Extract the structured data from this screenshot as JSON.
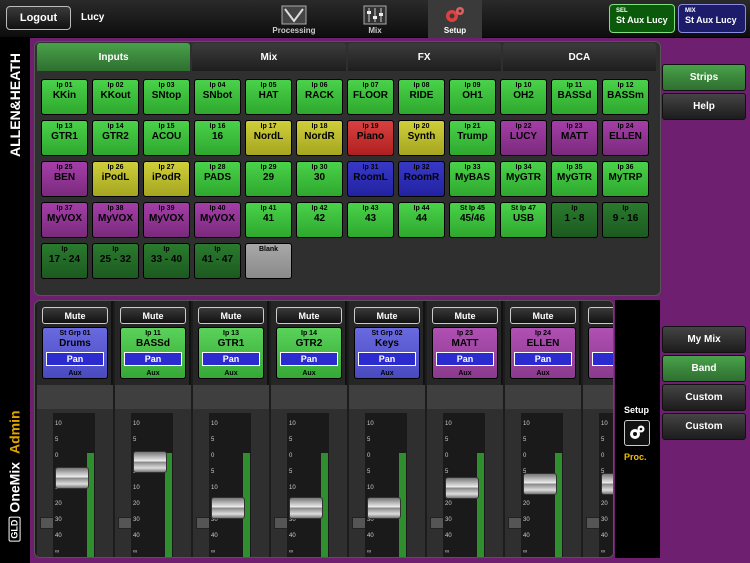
{
  "topbar": {
    "logout_label": "Logout",
    "user": "Lucy",
    "nav": [
      {
        "label": "Processing",
        "icon": "processing-icon"
      },
      {
        "label": "Mix",
        "icon": "mix-icon"
      },
      {
        "label": "Setup",
        "icon": "gear-icon"
      }
    ],
    "sel": {
      "tag": "SEL",
      "value": "St Aux Lucy"
    },
    "mix": {
      "tag": "MIX",
      "value": "St Aux Lucy"
    }
  },
  "brand": "ALLEN&HEATH",
  "product": {
    "badge": "GLD",
    "name": "OneMix",
    "role": "Admin"
  },
  "tabs": [
    "Inputs",
    "Mix",
    "FX",
    "DCA"
  ],
  "tiles": [
    {
      "s": "Ip 01",
      "l": "KKin",
      "c": "green"
    },
    {
      "s": "Ip 02",
      "l": "KKout",
      "c": "green"
    },
    {
      "s": "Ip 03",
      "l": "SNtop",
      "c": "green"
    },
    {
      "s": "Ip 04",
      "l": "SNbot",
      "c": "green"
    },
    {
      "s": "Ip 05",
      "l": "HAT",
      "c": "green"
    },
    {
      "s": "Ip 06",
      "l": "RACK",
      "c": "green"
    },
    {
      "s": "Ip 07",
      "l": "FLOOR",
      "c": "green"
    },
    {
      "s": "Ip 08",
      "l": "RIDE",
      "c": "green"
    },
    {
      "s": "Ip 09",
      "l": "OH1",
      "c": "green"
    },
    {
      "s": "Ip 10",
      "l": "OH2",
      "c": "green"
    },
    {
      "s": "Ip 11",
      "l": "BASSd",
      "c": "green"
    },
    {
      "s": "Ip 12",
      "l": "BASSm",
      "c": "green"
    },
    {
      "s": "Ip 13",
      "l": "GTR1",
      "c": "green"
    },
    {
      "s": "Ip 14",
      "l": "GTR2",
      "c": "green"
    },
    {
      "s": "Ip 15",
      "l": "ACOU",
      "c": "green"
    },
    {
      "s": "Ip 16",
      "l": "16",
      "c": "green"
    },
    {
      "s": "Ip 17",
      "l": "NordL",
      "c": "yellow"
    },
    {
      "s": "Ip 18",
      "l": "NordR",
      "c": "yellow"
    },
    {
      "s": "Ip 19",
      "l": "Piano",
      "c": "red"
    },
    {
      "s": "Ip 20",
      "l": "Synth",
      "c": "yellow"
    },
    {
      "s": "Ip 21",
      "l": "Trump",
      "c": "green"
    },
    {
      "s": "Ip 22",
      "l": "LUCY",
      "c": "purple"
    },
    {
      "s": "Ip 23",
      "l": "MATT",
      "c": "purple"
    },
    {
      "s": "Ip 24",
      "l": "ELLEN",
      "c": "purple"
    },
    {
      "s": "Ip 25",
      "l": "BEN",
      "c": "purple"
    },
    {
      "s": "Ip 26",
      "l": "iPodL",
      "c": "yellow"
    },
    {
      "s": "Ip 27",
      "l": "iPodR",
      "c": "yellow"
    },
    {
      "s": "Ip 28",
      "l": "PADS",
      "c": "green"
    },
    {
      "s": "Ip 29",
      "l": "29",
      "c": "green"
    },
    {
      "s": "Ip 30",
      "l": "30",
      "c": "green"
    },
    {
      "s": "Ip 31",
      "l": "RoomL",
      "c": "blue"
    },
    {
      "s": "Ip 32",
      "l": "RoomR",
      "c": "blue"
    },
    {
      "s": "Ip 33",
      "l": "MyBAS",
      "c": "green"
    },
    {
      "s": "Ip 34",
      "l": "MyGTR",
      "c": "green"
    },
    {
      "s": "Ip 35",
      "l": "MyGTR",
      "c": "green"
    },
    {
      "s": "Ip 36",
      "l": "MyTRP",
      "c": "green"
    },
    {
      "s": "Ip 37",
      "l": "MyVOX",
      "c": "purple"
    },
    {
      "s": "Ip 38",
      "l": "MyVOX",
      "c": "purple"
    },
    {
      "s": "Ip 39",
      "l": "MyVOX",
      "c": "purple"
    },
    {
      "s": "Ip 40",
      "l": "MyVOX",
      "c": "purple"
    },
    {
      "s": "Ip 41",
      "l": "41",
      "c": "green"
    },
    {
      "s": "Ip 42",
      "l": "42",
      "c": "green"
    },
    {
      "s": "Ip 43",
      "l": "43",
      "c": "green"
    },
    {
      "s": "Ip 44",
      "l": "44",
      "c": "green"
    },
    {
      "s": "St Ip 45",
      "l": "45/46",
      "c": "green"
    },
    {
      "s": "St Ip 47",
      "l": "USB",
      "c": "green"
    },
    {
      "s": "Ip",
      "l": "1 - 8",
      "c": "dkgreen"
    },
    {
      "s": "Ip",
      "l": "9 - 16",
      "c": "dkgreen"
    },
    {
      "s": "Ip",
      "l": "17 - 24",
      "c": "dkgreen"
    },
    {
      "s": "Ip",
      "l": "25 - 32",
      "c": "dkgreen"
    },
    {
      "s": "Ip",
      "l": "33 - 40",
      "c": "dkgreen"
    },
    {
      "s": "Ip",
      "l": "41 - 47",
      "c": "dkgreen"
    },
    {
      "s": "Blank",
      "l": "",
      "c": "gray"
    }
  ],
  "right_top": [
    "Strips",
    "Help"
  ],
  "right_bottom": [
    "My Mix",
    "Band",
    "Custom",
    "Custom"
  ],
  "strips": [
    {
      "mute": "Mute",
      "s": "St Grp 01",
      "l": "Drums",
      "pan": "Pan",
      "aux": "Aux",
      "c": "bl",
      "level": 0.55
    },
    {
      "mute": "Mute",
      "s": "Ip 11",
      "l": "BASSd",
      "pan": "Pan",
      "aux": "Aux",
      "c": "gr",
      "level": 0.68
    },
    {
      "mute": "Mute",
      "s": "Ip 13",
      "l": "GTR1",
      "pan": "Pan",
      "aux": "Aux",
      "c": "gr",
      "level": 0.3
    },
    {
      "mute": "Mute",
      "s": "Ip 14",
      "l": "GTR2",
      "pan": "Pan",
      "aux": "Aux",
      "c": "gr",
      "level": 0.3
    },
    {
      "mute": "Mute",
      "s": "St Grp 02",
      "l": "Keys",
      "pan": "Pan",
      "aux": "Aux",
      "c": "bl",
      "level": 0.3
    },
    {
      "mute": "Mute",
      "s": "Ip 23",
      "l": "MATT",
      "pan": "Pan",
      "aux": "Aux",
      "c": "pu",
      "level": 0.47
    },
    {
      "mute": "Mute",
      "s": "Ip 24",
      "l": "ELLEN",
      "pan": "Pan",
      "aux": "Aux",
      "c": "pu",
      "level": 0.5
    },
    {
      "mute": "M",
      "s": "Ip",
      "l": "E",
      "pan": "P",
      "aux": "",
      "c": "pu",
      "level": 0.5
    }
  ],
  "scale": [
    "10",
    "5",
    "0",
    "5",
    "10",
    "20",
    "30",
    "40",
    "∞"
  ],
  "bottom_side": {
    "setup": "Setup",
    "proc": "Proc."
  }
}
